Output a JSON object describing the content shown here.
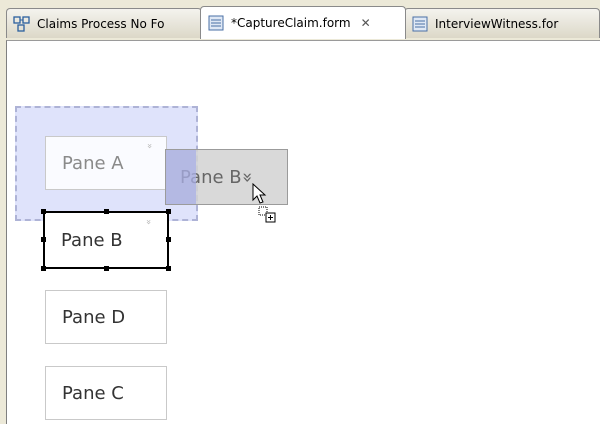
{
  "tabs": [
    {
      "label": "Claims Process No Fo",
      "icon": "process-diagram-icon",
      "active": false
    },
    {
      "label": "*CaptureClaim.form",
      "icon": "form-icon",
      "active": true,
      "close": "✕"
    },
    {
      "label": "InterviewWitness.for",
      "icon": "form-icon",
      "active": false
    }
  ],
  "canvas": {
    "panes": {
      "a": {
        "label": "Pane A",
        "chevron": "»"
      },
      "b": {
        "label": "Pane B",
        "chevron": "»",
        "selected": true
      },
      "d": {
        "label": "Pane D"
      },
      "c": {
        "label": "Pane C"
      }
    },
    "drag_ghost": {
      "label": "Pane B",
      "chevron": "»"
    }
  },
  "colors": {
    "dropzone_fill": "#d2d7fa",
    "tab_border": "#8a8a8a",
    "selection": "#000000"
  }
}
